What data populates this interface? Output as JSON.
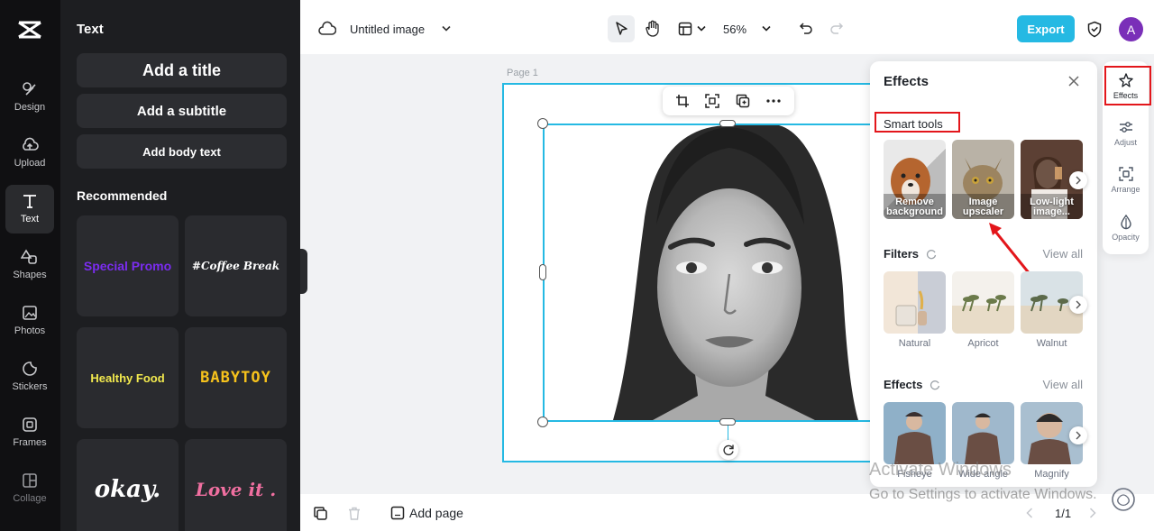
{
  "rail": {
    "items": [
      {
        "label": "Design",
        "icon": "design-icon"
      },
      {
        "label": "Upload",
        "icon": "upload-icon"
      },
      {
        "label": "Text",
        "icon": "text-icon",
        "active": true
      },
      {
        "label": "Shapes",
        "icon": "shapes-icon"
      },
      {
        "label": "Photos",
        "icon": "photos-icon"
      },
      {
        "label": "Stickers",
        "icon": "stickers-icon"
      },
      {
        "label": "Frames",
        "icon": "frames-icon"
      },
      {
        "label": "Collage",
        "icon": "collage-icon"
      }
    ]
  },
  "text_panel": {
    "title": "Text",
    "add_title": "Add a title",
    "add_subtitle": "Add a subtitle",
    "add_body": "Add body text",
    "recommended": "Recommended",
    "templates": [
      {
        "label": "Special Promo",
        "color": "#7b2cf0"
      },
      {
        "label": "#Coffee Break",
        "color": "#ffffff"
      },
      {
        "label": "Healthy Food",
        "color": "#f2e94e"
      },
      {
        "label": "BABYTOY",
        "color": "#f6c21c"
      },
      {
        "label": "okay.",
        "color": "#ffffff"
      },
      {
        "label": "Love it .",
        "color": "#f06fa0"
      }
    ]
  },
  "topbar": {
    "doc_title": "Untitled image",
    "zoom": "56%",
    "export_label": "Export",
    "avatar_letter": "A"
  },
  "canvas": {
    "page_label": "Page 1"
  },
  "bottombar": {
    "add_page": "Add page",
    "page_count": "1/1"
  },
  "effects_panel": {
    "title": "Effects",
    "smart_tools": {
      "title": "Smart tools",
      "items": [
        "Remove background",
        "Image upscaler",
        "Low-light image..."
      ]
    },
    "filters": {
      "title": "Filters",
      "view_all": "View all",
      "items": [
        "Natural",
        "Apricot",
        "Walnut"
      ]
    },
    "effects": {
      "title": "Effects",
      "view_all": "View all",
      "items": [
        "Fisheye",
        "Wide angle",
        "Magnify"
      ]
    }
  },
  "right_tools": {
    "items": [
      "Effects",
      "Adjust",
      "Arrange",
      "Opacity"
    ]
  },
  "watermark": {
    "line1": "Activate Windows",
    "line2": "Go to Settings to activate Windows."
  },
  "colors": {
    "accent": "#25b9e3",
    "highlight": "#e3161b",
    "rail_bg": "#101012",
    "panel_bg": "#1d1e21"
  }
}
